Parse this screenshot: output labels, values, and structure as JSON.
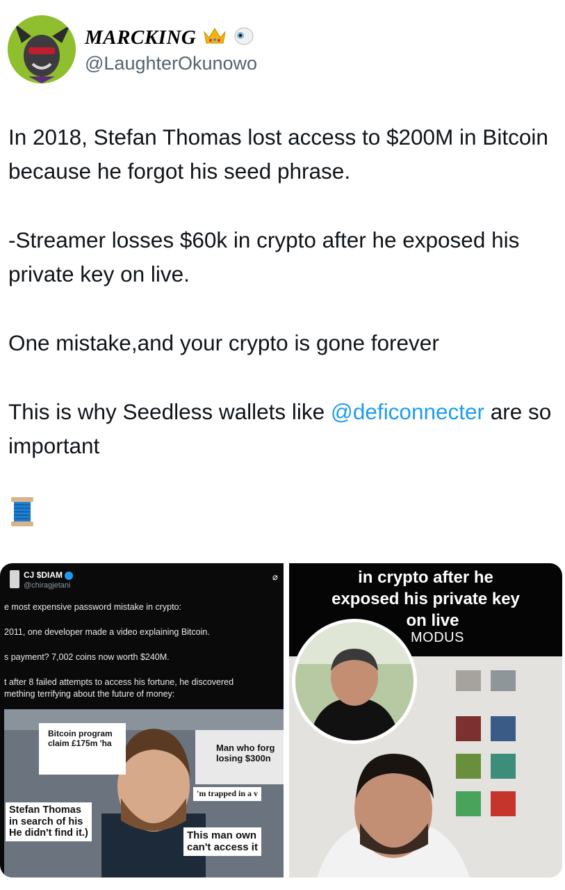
{
  "profile": {
    "display_name": "MARCKING",
    "handle": "@LaughterOkunowo",
    "emoji_icons": [
      "crown-icon",
      "eye-icon"
    ]
  },
  "tweet": {
    "p1": "In 2018, Stefan Thomas lost access to $200M in Bitcoin because he forgot his seed phrase.",
    "p2": "-Streamer losses $60k in crypto after he exposed his private key on live.",
    "p3": "One mistake,and your crypto is gone forever",
    "p4_before": "This is why Seedless wallets like ",
    "p4_mention": "@deficonnecter",
    "p4_after": " are so important",
    "thread_icon": "spool-of-thread-icon"
  },
  "media_left": {
    "author_name": "CJ $DIAM",
    "author_handle": "@chiragjetani",
    "lines": [
      "e most expensive password mistake in crypto:",
      "2011, one developer made a video explaining Bitcoin.",
      "s payment? 7,002 coins now worth $240M.",
      "t after 8 failed attempts to access his fortune, he discovered",
      "mething terrifying about the future of money:"
    ],
    "caption_left": "Stefan Thomas\nin search of his\nHe didn't find it.)",
    "caption_right": "This man own\ncan't access it",
    "headline_left": "Bitcoin program\nclaim £175m 'ha",
    "headline_right": "Man who forg\nlosing $300n",
    "trapped_text": "'m trapped in a v"
  },
  "media_right": {
    "overlay_lines": [
      "in crypto after he",
      "exposed his private key",
      "on live"
    ],
    "brand": "MODUS"
  },
  "colors": {
    "mention": "#1d9bf0",
    "handle": "#536471",
    "avatar_bg": "#8fbf2e"
  }
}
